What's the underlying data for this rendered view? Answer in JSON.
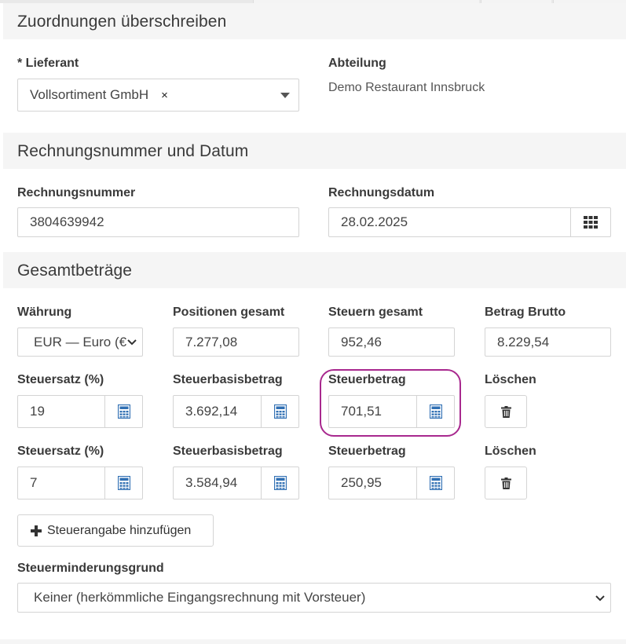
{
  "sections": {
    "assignments": "Zuordnungen überschreiben",
    "invoice": "Rechnungsnummer und Datum",
    "totals": "Gesamtbeträge"
  },
  "supplier": {
    "label": "* Lieferant",
    "value": "Vollsortiment GmbH",
    "clear": "×"
  },
  "department": {
    "label": "Abteilung",
    "value": "Demo Restaurant Innsbruck"
  },
  "invoice_number": {
    "label": "Rechnungsnummer",
    "value": "3804639942"
  },
  "invoice_date": {
    "label": "Rechnungsdatum",
    "value": "28.02.2025"
  },
  "currency": {
    "label": "Währung",
    "value": "EUR — Euro (€)"
  },
  "positions_total": {
    "label": "Positionen gesamt",
    "value": "7.277,08"
  },
  "taxes_total": {
    "label": "Steuern gesamt",
    "value": "952,46"
  },
  "gross_amount": {
    "label": "Betrag Brutto",
    "value": "8.229,54"
  },
  "tax_rows": [
    {
      "rate_label": "Steuersatz (%)",
      "rate": "19",
      "base_label": "Steuerbasisbetrag",
      "base": "3.692,14",
      "tax_label": "Steuerbetrag",
      "tax": "701,51",
      "delete_label": "Löschen"
    },
    {
      "rate_label": "Steuersatz (%)",
      "rate": "7",
      "base_label": "Steuerbasisbetrag",
      "base": "3.584,94",
      "tax_label": "Steuerbetrag",
      "tax": "250,95",
      "delete_label": "Löschen"
    }
  ],
  "add_tax_button": "Steuerangabe hinzufügen",
  "tax_reduction": {
    "label": "Steuerminderungsgrund",
    "value": "Keiner (herkömmliche Eingangsrechnung mit Vorsteuer)"
  },
  "colors": {
    "accent": "#2f6fb3",
    "highlight": "#a8288e"
  }
}
